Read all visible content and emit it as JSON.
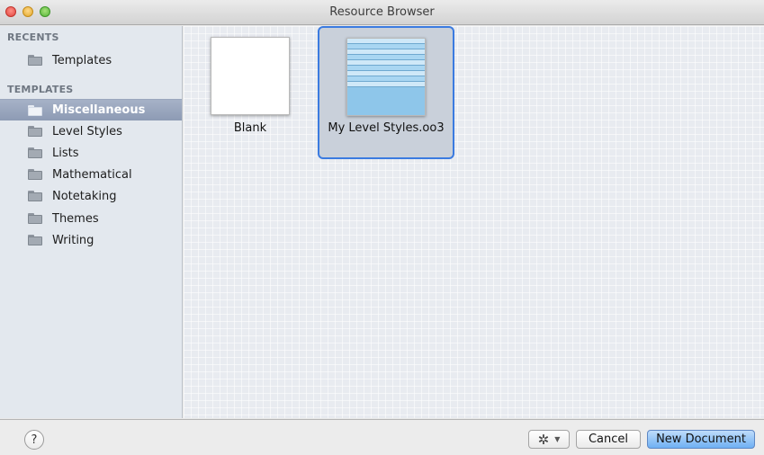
{
  "window": {
    "title": "Resource Browser"
  },
  "sidebar": {
    "recents_header": "RECENTS",
    "recents": [
      {
        "label": "Templates"
      }
    ],
    "templates_header": "TEMPLATES",
    "templates": [
      {
        "label": "Miscellaneous",
        "selected": true
      },
      {
        "label": "Level Styles"
      },
      {
        "label": "Lists"
      },
      {
        "label": "Mathematical"
      },
      {
        "label": "Notetaking"
      },
      {
        "label": "Themes"
      },
      {
        "label": "Writing"
      }
    ]
  },
  "main": {
    "items": [
      {
        "label": "Blank",
        "selected": false
      },
      {
        "label": "My Level Styles.oo3",
        "selected": true
      }
    ]
  },
  "footer": {
    "help_label": "?",
    "action_icon": "gear-icon",
    "cancel_label": "Cancel",
    "new_document_label": "New Document"
  },
  "colors": {
    "selection_border": "#3b7be0",
    "sidebar_selected": "#8d9bb4",
    "primary_button": "#6fb0f3"
  }
}
